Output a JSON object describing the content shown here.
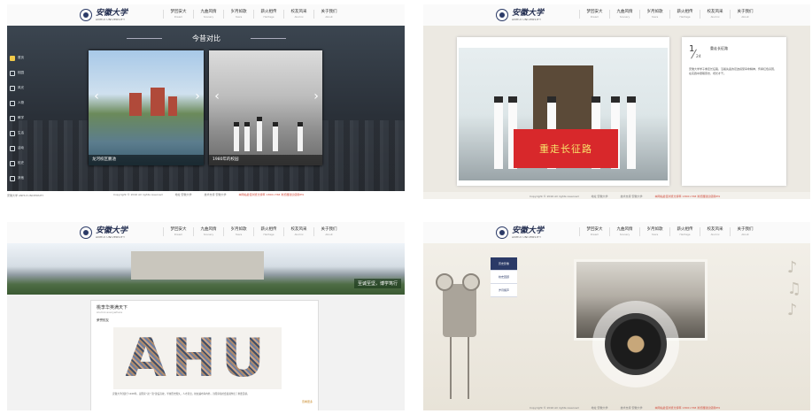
{
  "nav": {
    "logo_cn": "安徽大学",
    "logo_en": "ANHUI UNIVERSITY",
    "items": [
      {
        "cn": "梦回安大",
        "en": "Dream"
      },
      {
        "cn": "九曲风情",
        "en": "Scenery"
      },
      {
        "cn": "岁月如歌",
        "en": "Years"
      },
      {
        "cn": "薪火相传",
        "en": "Heritage"
      },
      {
        "cn": "校友风采",
        "en": "Alumni"
      },
      {
        "cn": "关于我们",
        "en": "About"
      }
    ]
  },
  "footer": {
    "copyright": "Copyright © 2016 All rights reserved",
    "address": "地址 安徽大学",
    "contact": "技术支持 安徽大学",
    "notice": "本网站最佳浏览分辨率 1366×768 浏览器建议使用IE9"
  },
  "panel1": {
    "title": "今昔对比",
    "sidebar": [
      "首页",
      "校园",
      "风光",
      "人物",
      "教学",
      "生活",
      "活动",
      "校史",
      "其他"
    ],
    "photos": [
      {
        "caption": "龙河校区鹏池"
      },
      {
        "caption": "1980年的校园"
      }
    ],
    "prev_label": "‹",
    "next_label": "›",
    "bottom_text": "安徽大学 ANHUI UNIVERSITY"
  },
  "panel2": {
    "banner": "重走长征路",
    "page_current": "1",
    "page_total": "24",
    "card_title": "重走长征路",
    "card_body": "安徽大学学子重走长征路，沿着先辈的足迹感受革命精神，传承红色基因，在实践中磨砺意志、增长才干。"
  },
  "panel3": {
    "slogan": "至诚至坚，博学笃行",
    "card_title": "桃李华英满天下",
    "card_sub": "Alumni everywhere",
    "card_label": "荣誉校友",
    "mosaic_text": "AHU",
    "card_text": "安徽大学创建于1928年，是国家“双一流”建设高校，学校历史悠久，人才辈出，校友遍布海内外，为国家和社会发展作出了重要贡献。",
    "more": "查看更多"
  },
  "panel4": {
    "menu": [
      "历史影像",
      "校史回顾",
      "岁月留声"
    ]
  }
}
